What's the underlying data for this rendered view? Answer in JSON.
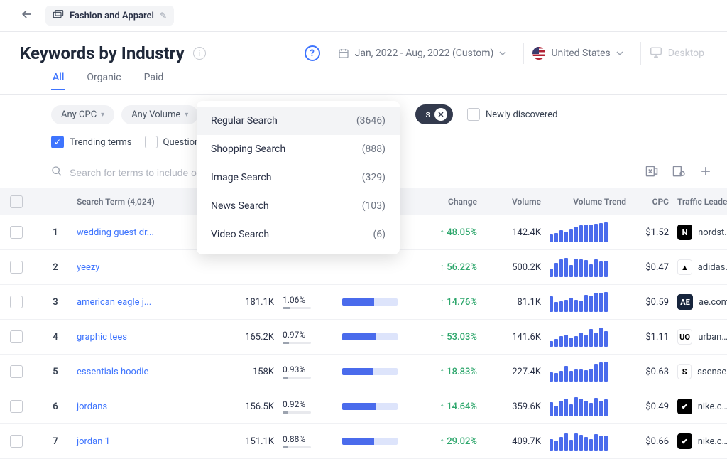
{
  "breadcrumb": {
    "label": "Fashion and Apparel"
  },
  "page_title": "Keywords by Industry",
  "date_range": "Jan, 2022 - Aug, 2022 (Custom)",
  "country": "United States",
  "device": "Desktop",
  "tabs": {
    "all": "All",
    "organic": "Organic",
    "paid": "Paid"
  },
  "filters": {
    "cpc": "Any CPC",
    "volume": "Any Volume"
  },
  "chip_suffix": "s",
  "newly_discovered": "Newly discovered",
  "trending_terms": "Trending terms",
  "question": "Question",
  "search_placeholder": "Search for terms to include or e",
  "dropdown": [
    {
      "label": "Regular Search",
      "count": "(3646)"
    },
    {
      "label": "Shopping Search",
      "count": "(888)"
    },
    {
      "label": "Image Search",
      "count": "(329)"
    },
    {
      "label": "News Search",
      "count": "(103)"
    },
    {
      "label": "Video Search",
      "count": "(6)"
    }
  ],
  "columns": {
    "search_term": "Search Term (4,024)",
    "change": "Change",
    "volume": "Volume",
    "volume_trend": "Volume Trend",
    "cpc": "CPC",
    "traffic_leader": "Traffic Leader"
  },
  "rows": [
    {
      "rank": "1",
      "term": "wedding guest dr...",
      "clicks": "",
      "share": "",
      "shareW": 0,
      "compA": 0,
      "change": "48.05%",
      "volume": "142.4K",
      "bars": [
        40,
        45,
        60,
        55,
        65,
        80,
        85,
        90,
        88,
        92,
        95,
        100
      ],
      "cpc": "$1.52",
      "fav": "N",
      "favBg": "#000",
      "favFg": "#fff",
      "domain": "nordstr..."
    },
    {
      "rank": "2",
      "term": "yeezy",
      "clicks": "",
      "share": "",
      "shareW": 0,
      "compA": 0,
      "change": "56.22%",
      "volume": "500.2K",
      "bars": [
        42,
        70,
        88,
        95,
        60,
        92,
        90,
        85,
        65,
        88,
        78,
        82
      ],
      "cpc": "$0.47",
      "fav": "▲",
      "favBg": "#fff",
      "favFg": "#000",
      "domain": "adidas...."
    },
    {
      "rank": "3",
      "term": "american eagle j...",
      "clicks": "181.1K",
      "share": "1.06%",
      "shareW": 24,
      "compA": 58,
      "change": "14.76%",
      "volume": "81.1K",
      "bars": [
        78,
        50,
        52,
        60,
        72,
        62,
        58,
        85,
        82,
        95,
        98,
        100
      ],
      "cpc": "$0.59",
      "fav": "AE",
      "favBg": "#17253D",
      "favFg": "#fff",
      "domain": "ae.com"
    },
    {
      "rank": "4",
      "term": "graphic tees",
      "clicks": "165.2K",
      "share": "0.97%",
      "shareW": 22,
      "compA": 62,
      "change": "53.03%",
      "volume": "141.6K",
      "bars": [
        30,
        40,
        55,
        62,
        48,
        52,
        70,
        60,
        88,
        72,
        98,
        78
      ],
      "cpc": "$1.11",
      "fav": "UO",
      "favBg": "#fff",
      "favFg": "#000",
      "domain": "urbano..."
    },
    {
      "rank": "5",
      "term": "essentials hoodie",
      "clicks": "158K",
      "share": "0.93%",
      "shareW": 21,
      "compA": 55,
      "change": "18.83%",
      "volume": "227.4K",
      "bars": [
        48,
        42,
        55,
        78,
        52,
        60,
        62,
        58,
        65,
        90,
        95,
        100
      ],
      "cpc": "$0.63",
      "fav": "S",
      "favBg": "#fff",
      "favFg": "#000",
      "domain": "ssense...."
    },
    {
      "rank": "6",
      "term": "jordans",
      "clicks": "156.5K",
      "share": "0.92%",
      "shareW": 21,
      "compA": 60,
      "change": "14.64%",
      "volume": "359.6K",
      "bars": [
        70,
        52,
        78,
        90,
        62,
        95,
        88,
        78,
        68,
        92,
        80,
        85
      ],
      "cpc": "$0.49",
      "fav": "✔",
      "favBg": "#000",
      "favFg": "#fff",
      "domain": "nike.com"
    },
    {
      "rank": "7",
      "term": "jordan 1",
      "clicks": "151.1K",
      "share": "0.88%",
      "shareW": 20,
      "compA": 58,
      "change": "29.02%",
      "volume": "409.7K",
      "bars": [
        60,
        55,
        72,
        88,
        58,
        90,
        82,
        72,
        62,
        85,
        78,
        80
      ],
      "cpc": "$0.66",
      "fav": "✔",
      "favBg": "#000",
      "favFg": "#fff",
      "domain": "nike.com"
    }
  ]
}
